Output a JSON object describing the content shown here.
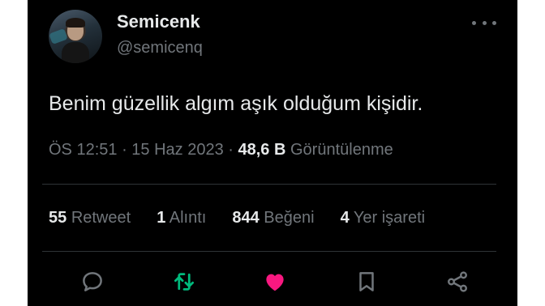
{
  "author": {
    "name": "Semicenk",
    "handle": "@semicenq"
  },
  "tweet": {
    "text": "Benim güzellik algım aşık olduğum kişidir."
  },
  "meta": {
    "time": "ÖS 12:51",
    "separator1": " · ",
    "date": "15 Haz 2023",
    "separator2": " · ",
    "views_count": "48,6 B",
    "views_label": "Görüntülenme"
  },
  "stats": {
    "retweets_count": "55",
    "retweets_label": "Retweet",
    "quotes_count": "1",
    "quotes_label": "Alıntı",
    "likes_count": "844",
    "likes_label": "Beğeni",
    "bookmarks_count": "4",
    "bookmarks_label": "Yer işareti"
  },
  "actions": {
    "icons": [
      "reply-icon",
      "retweet-icon",
      "like-icon",
      "bookmark-icon",
      "share-icon"
    ],
    "retweet_color": "#00ba7c",
    "like_color": "#f91880",
    "default_color": "#71767b"
  },
  "colors": {
    "background": "#000000",
    "text_primary": "#e7e9ea",
    "text_secondary": "#71767b"
  }
}
